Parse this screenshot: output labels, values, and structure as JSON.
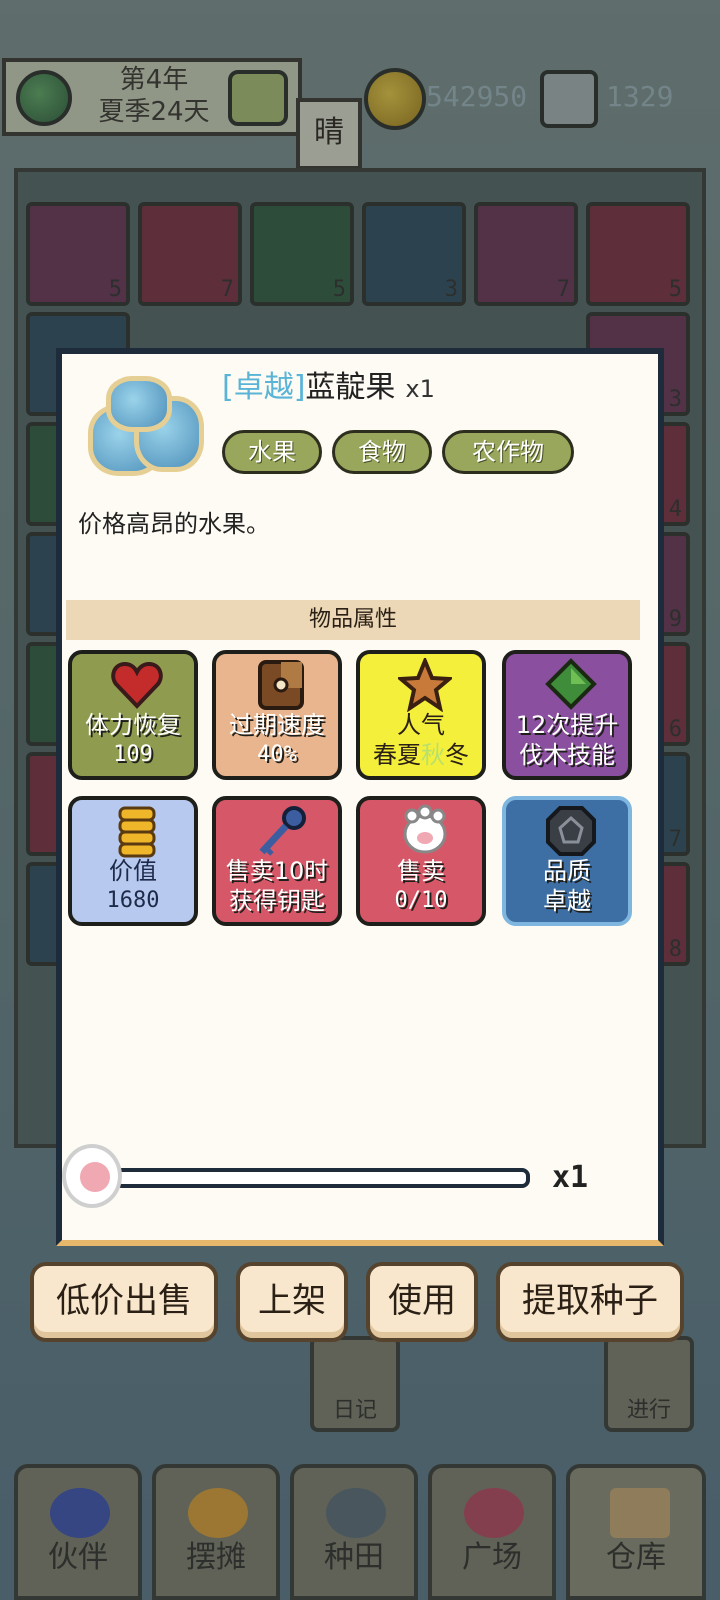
{
  "header": {
    "year": "第4年",
    "day": "夏季24天",
    "weather": "晴",
    "coins": "542950",
    "gems": "1329"
  },
  "background": {
    "grid_counts": [
      "3",
      "4",
      "7",
      "6",
      "5",
      "7",
      "5",
      "3",
      "7",
      "5"
    ],
    "side_counts": [
      "3",
      "4",
      "9",
      "6",
      "7",
      "8"
    ],
    "diary_label": "日记",
    "proceed_label": "进行"
  },
  "bottom_nav": [
    {
      "label": "伙伴",
      "icon": "partner-icon"
    },
    {
      "label": "摆摊",
      "icon": "stall-icon"
    },
    {
      "label": "种田",
      "icon": "watering-can-icon"
    },
    {
      "label": "广场",
      "icon": "flower-icon"
    },
    {
      "label": "仓库",
      "icon": "house-icon"
    }
  ],
  "item": {
    "quality_tag": "[卓越]",
    "name": "蓝靛果",
    "count": "x1",
    "icon": "blueberry-icon",
    "tags": [
      "水果",
      "食物",
      "农作物"
    ],
    "description": "价格高昂的水果。"
  },
  "attributes_header": "物品属性",
  "attributes": [
    {
      "icon": "heart-icon",
      "line1": "体力恢复",
      "line2": "109",
      "color": "#8f9b4e"
    },
    {
      "icon": "clock-icon",
      "line1": "过期速度",
      "line2": "40%",
      "color": "#e8b58e"
    },
    {
      "icon": "star-icon",
      "line1": "人气",
      "line2_a": "春夏",
      "line2_b": "秋",
      "line2_c": "冬",
      "color": "#f4ef3b"
    },
    {
      "icon": "green-gem-icon",
      "line1": "12次提升",
      "line2": "伐木技能",
      "color": "#8a4f9e"
    },
    {
      "icon": "coin-stack-icon",
      "line1": "价值",
      "line2": "1680",
      "color": "#b8c9ef"
    },
    {
      "icon": "key-icon",
      "line1": "售卖10时",
      "line2": "获得钥匙",
      "color": "#d65868"
    },
    {
      "icon": "paw-glove-icon",
      "line1": "售卖",
      "line2": "0/10",
      "color": "#d65868"
    },
    {
      "icon": "quality-badge-icon",
      "line1": "品质",
      "line2": "卓越",
      "color": "#3d6fa4"
    }
  ],
  "slider": {
    "quantity": "x1",
    "value": 0
  },
  "actions": [
    "低价出售",
    "上架",
    "使用",
    "提取种子"
  ]
}
